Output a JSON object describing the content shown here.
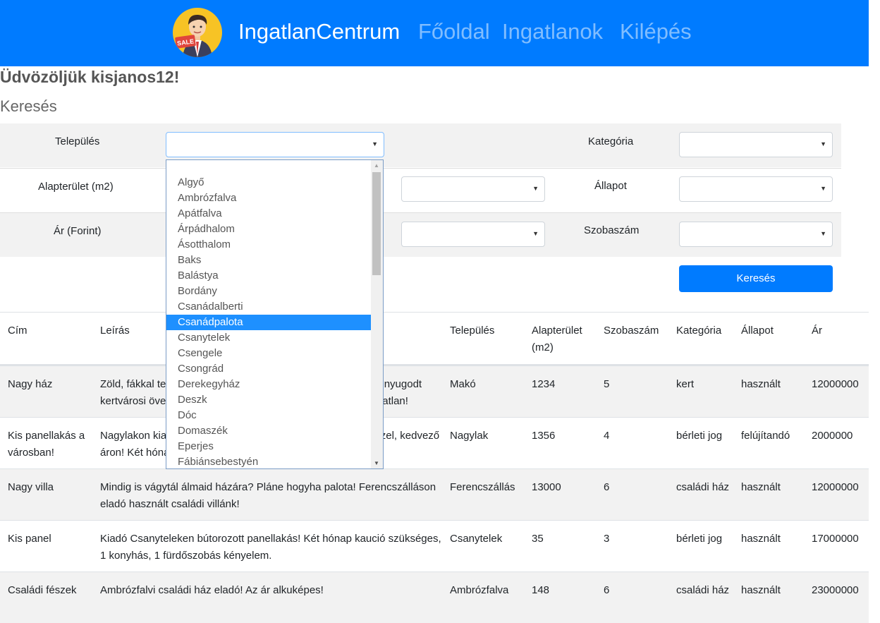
{
  "header": {
    "brand": "IngatlanCentrum",
    "nav": [
      "Főoldal",
      "Ingatlanok",
      "Kilépés"
    ],
    "logo_text": "SALE"
  },
  "welcome": "Üdvözöljük kisjanos12!",
  "search": {
    "title": "Keresés",
    "labels": {
      "telepules": "Település",
      "kategoria": "Kategória",
      "alapterulet": "Alapterület (m2)",
      "allapot": "Állapot",
      "ar": "Ár (Forint)",
      "szobaszam": "Szobaszám"
    },
    "button": "Keresés"
  },
  "dropdown": {
    "items": [
      "Algyő",
      "Ambrózfalva",
      "Apátfalva",
      "Árpádhalom",
      "Ásotthalom",
      "Baks",
      "Balástya",
      "Bordány",
      "Csanádalberti",
      "Csanádpalota",
      "Csanytelek",
      "Csengele",
      "Csongrád",
      "Derekegyház",
      "Deszk",
      "Dóc",
      "Domaszék",
      "Eperjes",
      "Fábiánsebestyén"
    ],
    "highlighted": "Csanádpalota"
  },
  "table": {
    "headers": [
      "Cím",
      "Leírás",
      "Település",
      "Alapterület (m2)",
      "Szobaszám",
      "Kategória",
      "Állapot",
      "Ár"
    ],
    "rows": [
      [
        "Nagy ház",
        "Zöld, fákkal teli kertes ház a város egyik legszebb, csendes, nyugodt kertvárosi övezetében! Jó állapotú, használt, mégis szép ingatlan!",
        "Makó",
        "1234",
        "5",
        "kert",
        "használt",
        "12000000"
      ],
      [
        "Kis panellakás a városban!",
        "Nagylakon kiadó kis panellakás a belvárosban, a főúthoz közel, kedvező áron! Két hónap kaució szükséges.",
        "Nagylak",
        "1356",
        "4",
        "bérleti jog",
        "felújítandó",
        "2000000"
      ],
      [
        "Nagy villa",
        "Mindig is vágytál álmaid házára? Pláne hogyha palota! Ferencszálláson eladó használt családi villánk!",
        "Ferencszállás",
        "13000",
        "6",
        "családi ház",
        "használt",
        "12000000"
      ],
      [
        "Kis panel",
        "Kiadó Csanyteleken bútorozott panellakás! Két hónap kaució szükséges, 1 konyhás, 1 fürdőszobás kényelem.",
        "Csanytelek",
        "35",
        "3",
        "bérleti jog",
        "használt",
        "17000000"
      ],
      [
        "Családi fészek",
        "Ambrózfalvi családi ház eladó! Az ár alkuképes!",
        "Ambrózfalva",
        "148",
        "6",
        "családi ház",
        "használt",
        "23000000"
      ]
    ]
  },
  "colors": {
    "primary": "#007bff",
    "row_stripe": "#f2f2f2",
    "highlight": "#1e90ff"
  }
}
